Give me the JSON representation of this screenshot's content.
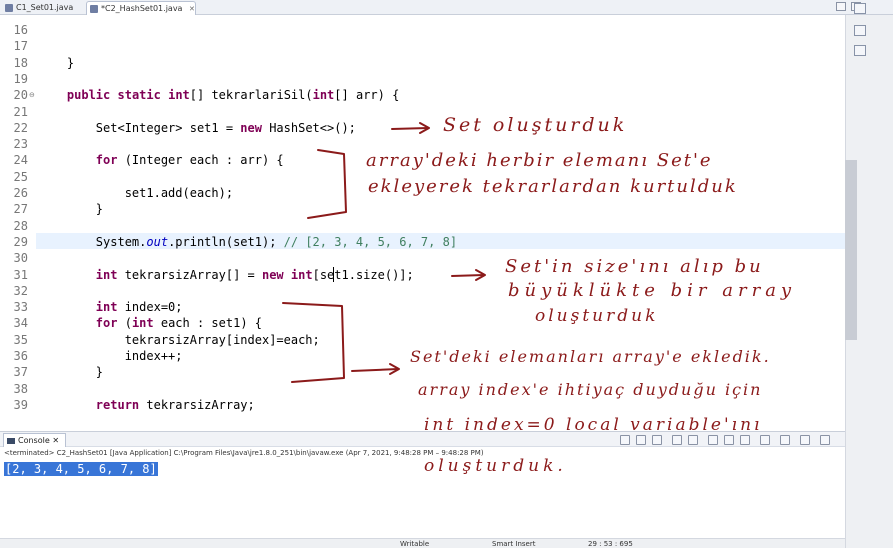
{
  "tabs": [
    {
      "label": "C1_Set01.java",
      "active": false
    },
    {
      "label": "*C2_HashSet01.java",
      "active": true
    }
  ],
  "code": {
    "lines": [
      {
        "num": "16",
        "html": ""
      },
      {
        "num": "17",
        "html": ""
      },
      {
        "num": "18",
        "html": "    }"
      },
      {
        "num": "19",
        "html": ""
      },
      {
        "num": "20",
        "html": "    <span class=\"kw\">public</span> <span class=\"kw\">static</span> <span class=\"kw\">int</span>[] tekrarlariSil(<span class=\"kw\">int</span>[] arr) {"
      },
      {
        "num": "21",
        "html": ""
      },
      {
        "num": "22",
        "html": "        Set&lt;Integer&gt; set1 = <span class=\"kw\">new</span> HashSet&lt;&gt;();"
      },
      {
        "num": "23",
        "html": ""
      },
      {
        "num": "24",
        "html": "        <span class=\"kw\">for</span> (Integer each : arr) {"
      },
      {
        "num": "25",
        "html": ""
      },
      {
        "num": "26",
        "html": "            set1.add(each);"
      },
      {
        "num": "27",
        "html": "        }"
      },
      {
        "num": "28",
        "html": ""
      },
      {
        "num": "29",
        "html": "        System.<span class=\"fld\">out</span>.println(set1); <span class=\"cm\">// [2, 3, 4, 5, 6, 7, 8]</span>"
      },
      {
        "num": "30",
        "html": ""
      },
      {
        "num": "31",
        "html": "        <span class=\"kw\">int</span> tekrarsizArray[] = <span class=\"kw\">new</span> <span class=\"kw\">int</span>[set1.size()];"
      },
      {
        "num": "32",
        "html": ""
      },
      {
        "num": "33",
        "html": "        <span class=\"kw\">int</span> index=0;"
      },
      {
        "num": "34",
        "html": "        <span class=\"kw\">for</span> (<span class=\"kw\">int</span> each : set1) {"
      },
      {
        "num": "35",
        "html": "            tekrarsizArray[index]=each;"
      },
      {
        "num": "36",
        "html": "            index++;"
      },
      {
        "num": "37",
        "html": "        }"
      },
      {
        "num": "38",
        "html": ""
      },
      {
        "num": "39",
        "html": "        <span class=\"kw\">return</span> tekrarsizArray;"
      }
    ],
    "highlighted_line": "29"
  },
  "console": {
    "tab_label": "Console",
    "terminated": "<terminated> C2_HashSet01 [Java Application] C:\\Program Files\\Java\\jre1.8.0_251\\bin\\javaw.exe  (Apr 7, 2021, 9:48:28 PM – 9:48:28 PM)",
    "output": "[2, 3, 4, 5, 6, 7, 8]"
  },
  "status": {
    "writable": "Writable",
    "insert_mode": "Smart Insert",
    "position": "29 : 53 : 695"
  },
  "annotations": [
    "Set oluşturduk",
    "array'deki herbir elemanı Set'e",
    "ekleyerek tekrarlardan kurtulduk",
    "Set'in size'ını alıp bu",
    "büyüklükte bir array",
    "oluşturduk",
    "Set'deki elemanları array'e ekledik.",
    "array index'e ihtiyaç duyduğu için",
    "int index=0 local variable'ını",
    "oluşturduk."
  ],
  "colors": {
    "keyword": "#7f0055",
    "comment": "#3f7f5f",
    "field": "#0000c0",
    "ink": "#8b1a1a",
    "selection": "#3875d7"
  }
}
